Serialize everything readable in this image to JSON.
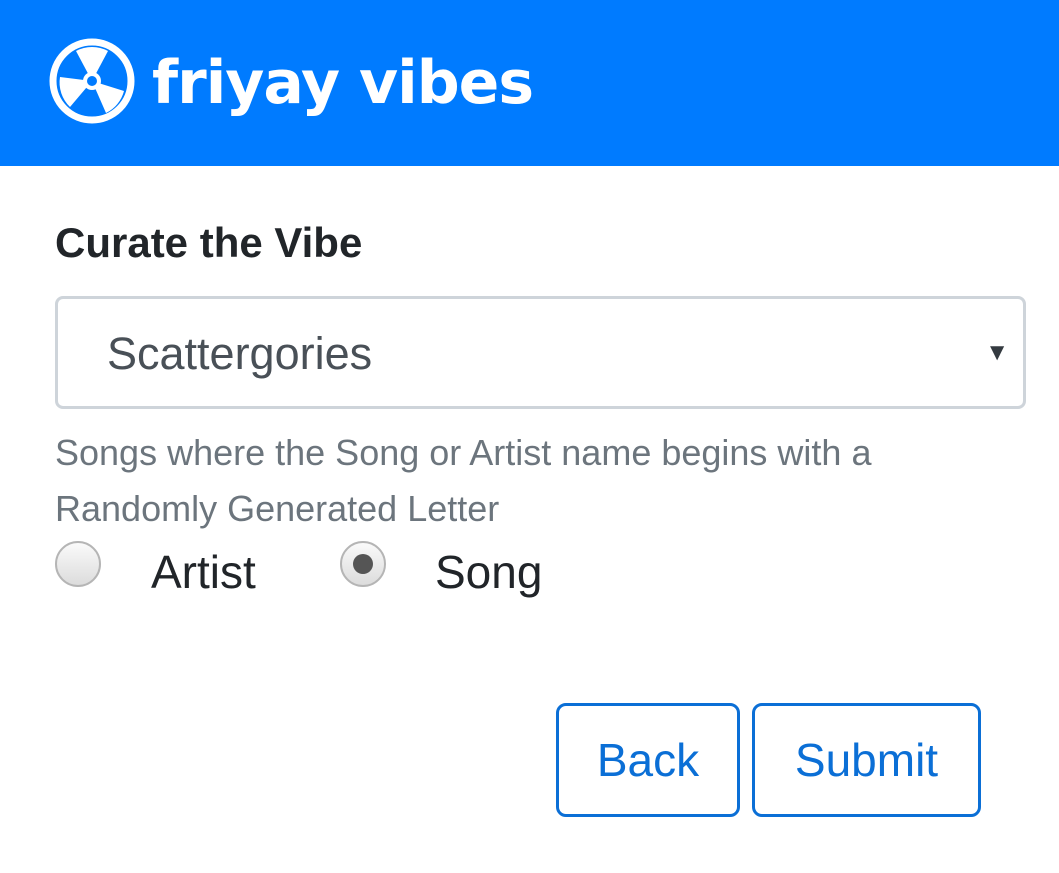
{
  "header": {
    "logo_icon": "vinyl-record-icon",
    "brand": "friyay vibes",
    "background_color": "#007bff"
  },
  "form": {
    "title": "Curate the Vibe",
    "select": {
      "value": "Scattergories",
      "arrow": "▼"
    },
    "description": "Songs where the Song or Artist name begins with a Randomly Generated Letter",
    "radio_options": [
      {
        "label": "Artist",
        "checked": false
      },
      {
        "label": "Song",
        "checked": true
      }
    ],
    "buttons": {
      "back": "Back",
      "submit": "Submit"
    },
    "accent_color": "#0b6fd6"
  }
}
